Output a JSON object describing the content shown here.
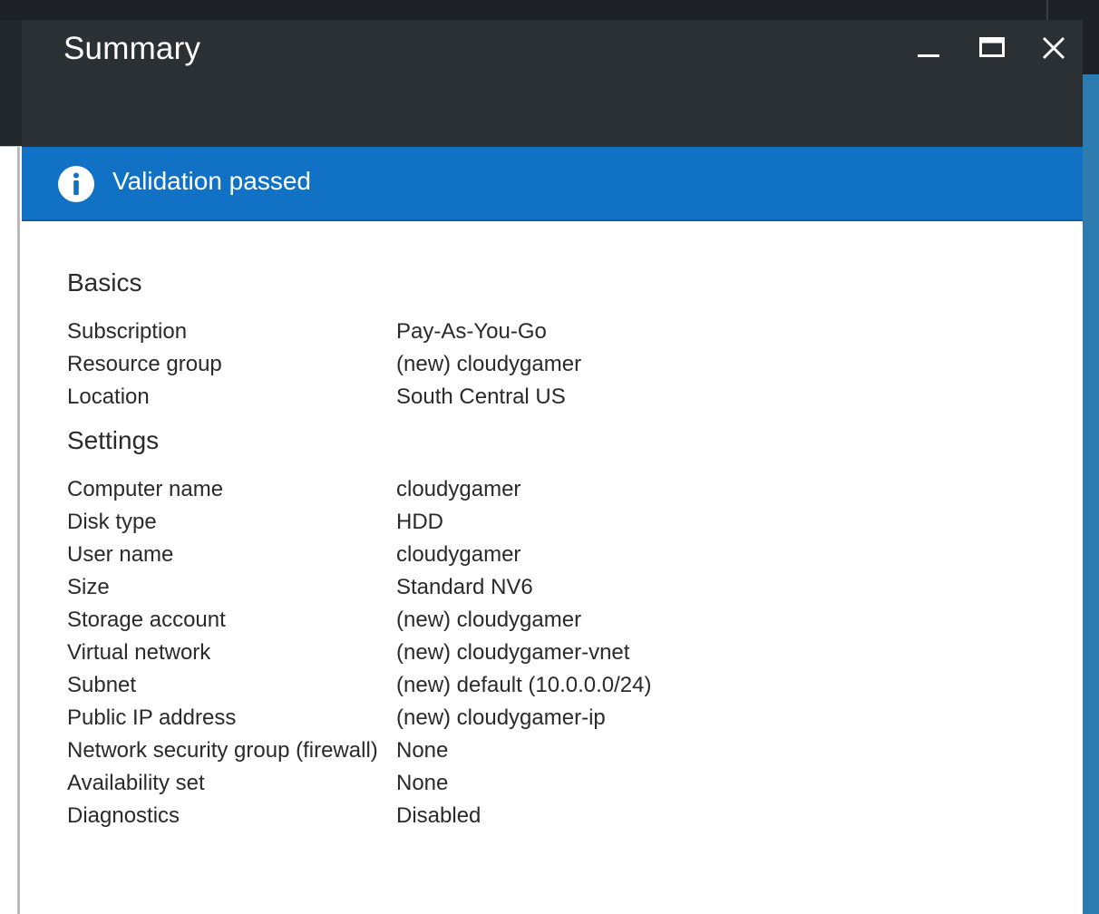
{
  "window": {
    "title": "Summary",
    "controls": {
      "minimize_icon": "minimize-icon",
      "maximize_icon": "maximize-icon",
      "close_icon": "close-icon"
    }
  },
  "banner": {
    "icon": "info-icon",
    "message": "Validation passed",
    "color": "#1172c5"
  },
  "sections": {
    "basics": {
      "title": "Basics",
      "rows": [
        {
          "label": "Subscription",
          "value": "Pay-As-You-Go"
        },
        {
          "label": "Resource group",
          "value": "(new) cloudygamer"
        },
        {
          "label": "Location",
          "value": "South Central US"
        }
      ]
    },
    "settings": {
      "title": "Settings",
      "rows": [
        {
          "label": "Computer name",
          "value": "cloudygamer"
        },
        {
          "label": "Disk type",
          "value": "HDD"
        },
        {
          "label": "User name",
          "value": "cloudygamer"
        },
        {
          "label": "Size",
          "value": "Standard NV6"
        },
        {
          "label": "Storage account",
          "value": "(new) cloudygamer"
        },
        {
          "label": "Virtual network",
          "value": "(new) cloudygamer-vnet"
        },
        {
          "label": "Subnet",
          "value": "(new) default (10.0.0.0/24)"
        },
        {
          "label": "Public IP address",
          "value": "(new) cloudygamer-ip"
        },
        {
          "label": "Network security group (firewall)",
          "value": "None"
        },
        {
          "label": "Availability set",
          "value": "None"
        },
        {
          "label": "Diagnostics",
          "value": "Disabled"
        }
      ]
    }
  },
  "colors": {
    "header_bg": "#2b3035",
    "accent": "#1172c5"
  }
}
